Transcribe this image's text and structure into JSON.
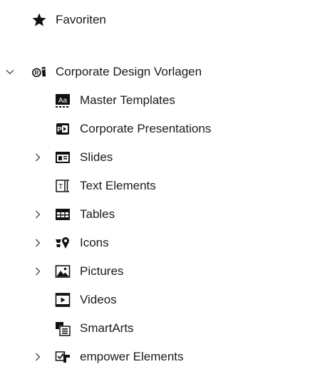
{
  "tree": {
    "favorites": {
      "label": "Favoriten",
      "icon": "star-icon"
    },
    "root": {
      "label": "Corporate Design Vorlagen",
      "icon": "corporate-design-icon",
      "expanded": true,
      "children": [
        {
          "label": "Master Templates",
          "icon": "master-templates-icon",
          "expandable": false
        },
        {
          "label": "Corporate Presentations",
          "icon": "presentation-icon",
          "expandable": false
        },
        {
          "label": "Slides",
          "icon": "slides-icon",
          "expandable": true
        },
        {
          "label": "Text Elements",
          "icon": "text-elements-icon",
          "expandable": false
        },
        {
          "label": "Tables",
          "icon": "table-icon",
          "expandable": true
        },
        {
          "label": "Icons",
          "icon": "icons-icon",
          "expandable": true
        },
        {
          "label": "Pictures",
          "icon": "picture-icon",
          "expandable": true
        },
        {
          "label": "Videos",
          "icon": "video-icon",
          "expandable": false
        },
        {
          "label": "SmartArts",
          "icon": "smartart-icon",
          "expandable": false
        },
        {
          "label": "empower Elements",
          "icon": "empower-elements-icon",
          "expandable": true
        }
      ]
    }
  }
}
